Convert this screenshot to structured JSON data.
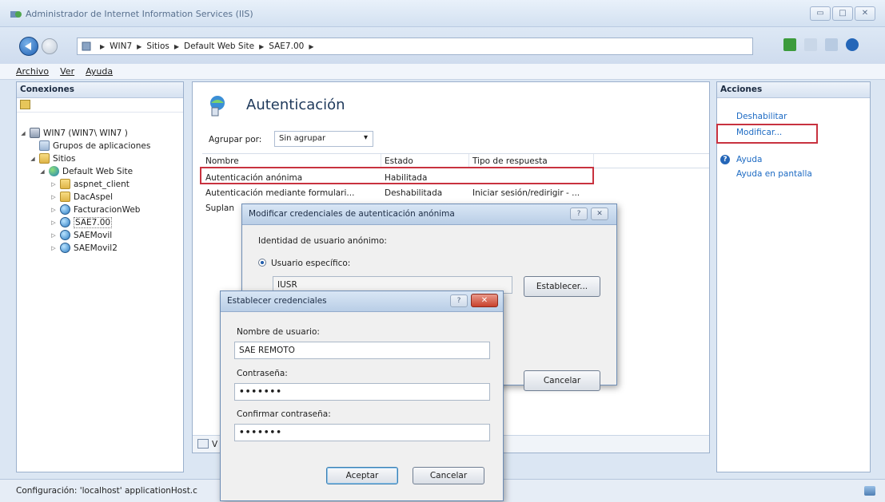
{
  "window": {
    "title": "Administrador de Internet Information Services (IIS)",
    "minimize": "▭",
    "maximize": "□",
    "close": "✕"
  },
  "breadcrumb": [
    "WIN7",
    "Sitios",
    "Default Web Site",
    "SAE7.00",
    ""
  ],
  "menu": [
    "Archivo",
    "Ver",
    "Ayuda"
  ],
  "connections": {
    "title": "Conexiones",
    "tree": [
      {
        "label": "WIN7 (WIN7\\ WIN7 )",
        "icon": "server-icon",
        "expander": "◢"
      },
      {
        "label": "Grupos de aplicaciones",
        "icon": "app-pool-icon",
        "expander": ""
      },
      {
        "label": "Sitios",
        "icon": "sites-folder-icon",
        "expander": "◢"
      },
      {
        "label": "Default Web Site",
        "icon": "globe-icon",
        "expander": "◢"
      },
      {
        "label": "aspnet_client",
        "icon": "folder-icon",
        "expander": "▷"
      },
      {
        "label": "DacAspel",
        "icon": "folder-icon",
        "expander": "▷"
      },
      {
        "label": "FacturacionWeb",
        "icon": "application-icon",
        "expander": "▷"
      },
      {
        "label": "SAE7.00",
        "icon": "application-icon",
        "expander": "▷"
      },
      {
        "label": "SAEMovil",
        "icon": "application-icon",
        "expander": "▷"
      },
      {
        "label": "SAEMovil2",
        "icon": "application-icon",
        "expander": "▷"
      }
    ]
  },
  "feature": {
    "title": "Autenticación",
    "group_by_label": "Agrupar por:",
    "group_by_value": "Sin agrupar",
    "columns": [
      "Nombre",
      "Estado",
      "Tipo de respuesta"
    ],
    "rows": [
      [
        "Autenticación anónima",
        "Habilitada",
        ""
      ],
      [
        "Autenticación mediante formulari...",
        "Deshabilitada",
        "Iniciar sesión/redirigir - ..."
      ],
      [
        "Suplan",
        "",
        ""
      ]
    ],
    "view_label": "V"
  },
  "actions": {
    "title": "Acciones",
    "disable": "Deshabilitar",
    "edit": "Modificar...",
    "help": "Ayuda",
    "online_help": "Ayuda en pantalla"
  },
  "status": {
    "text": "Configuración: 'localhost' applicationHost.c"
  },
  "dialog_anon": {
    "title": "Modificar credenciales de autenticación anónima",
    "help_btn": "?",
    "close_btn": "✕",
    "identity_label": "Identidad de usuario anónimo:",
    "specific_user_label": "Usuario específico:",
    "user_value": "IUSR",
    "set_button": "Establecer...",
    "cancel_button": "Cancelar"
  },
  "dialog_creds": {
    "title": "Establecer credenciales",
    "help_btn": "?",
    "close_btn": "✕",
    "username_label": "Nombre de usuario:",
    "username_value": "SAE REMOTO",
    "password_label": "Contraseña:",
    "password_value": "•••••••",
    "confirm_label": "Confirmar contraseña:",
    "confirm_value": "•••••••",
    "ok_button": "Aceptar",
    "cancel_button": "Cancelar"
  },
  "colors": {
    "highlight_box": "#c8323f",
    "link": "#1c6ac3",
    "title_text": "#1e395b"
  }
}
